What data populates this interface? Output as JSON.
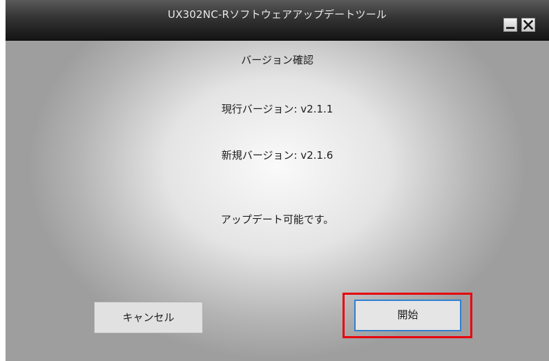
{
  "window": {
    "title": "UX302NC-Rソフトウェアアップデートツール"
  },
  "icons": {
    "minimize": "minimize-icon",
    "close": "close-icon"
  },
  "content": {
    "heading": "バージョン確認",
    "current_version": "現行バージョン:  v2.1.1",
    "new_version": "新規バージョン:  v2.1.6",
    "status": "アップデート可能です。"
  },
  "buttons": {
    "cancel_label": "キャンセル",
    "start_label": "開始"
  },
  "colors": {
    "highlight": "#e8000b",
    "focus_border": "#2f7fd0"
  }
}
